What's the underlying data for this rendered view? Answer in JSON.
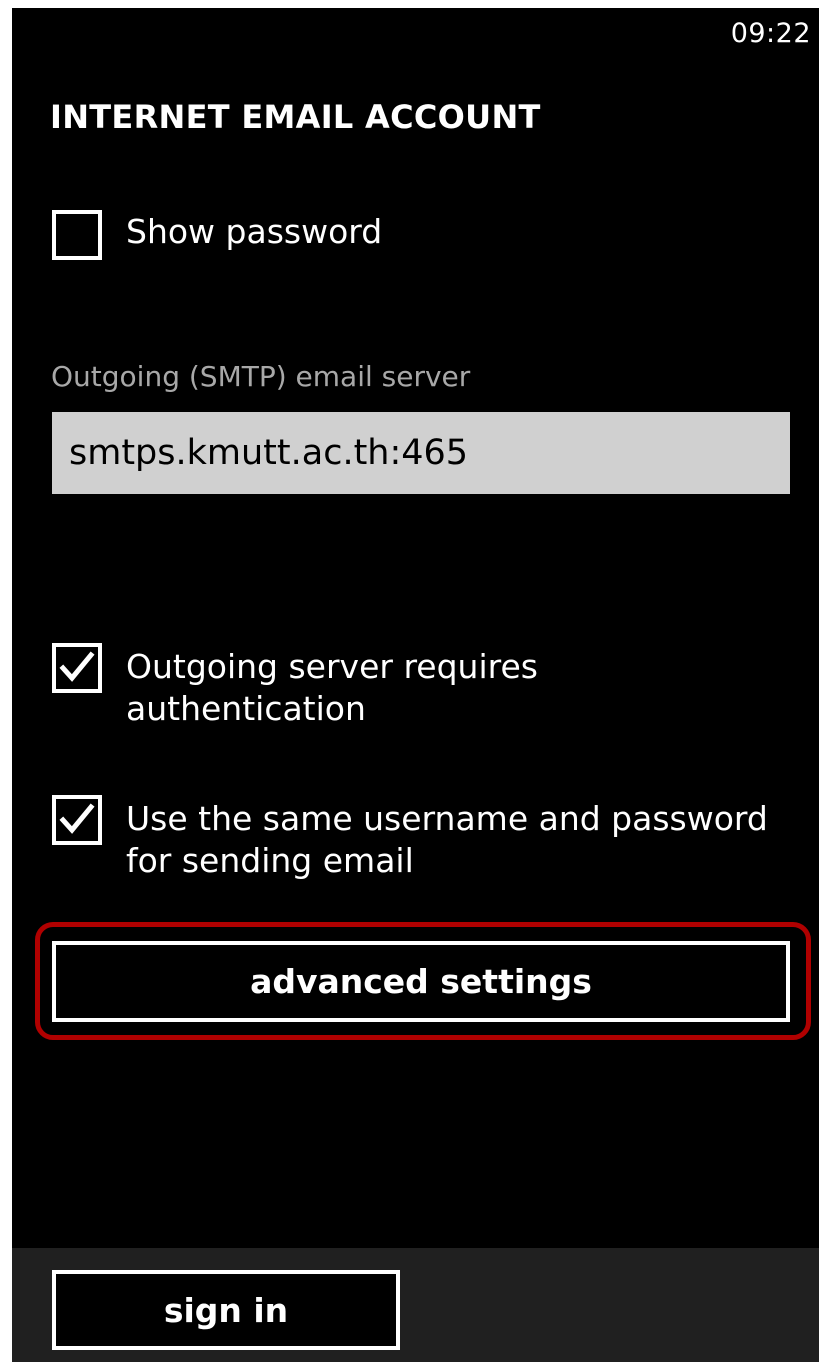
{
  "status_bar": {
    "time": "09:22"
  },
  "page": {
    "title": "INTERNET EMAIL ACCOUNT"
  },
  "show_password": {
    "label": "Show password",
    "checked": false
  },
  "smtp": {
    "label": "Outgoing (SMTP) email server",
    "value": "smtps.kmutt.ac.th:465"
  },
  "auth_required": {
    "label_line1": "Outgoing server requires",
    "label_line2": "authentication",
    "checked": true
  },
  "same_credentials": {
    "label_line1": "Use the same username and password",
    "label_line2": "for sending email",
    "checked": true
  },
  "advanced_settings": {
    "label": "advanced settings",
    "highlight_color": "#b00000"
  },
  "app_bar": {
    "sign_in_label": "sign in",
    "background": "#202020"
  },
  "theme": {
    "background": "#000000",
    "foreground": "#ffffff",
    "subtle_text": "#a8a8a8",
    "input_background": "#d0d0d0"
  },
  "icons": [
    "checkmark-icon",
    "checkmark-icon"
  ]
}
